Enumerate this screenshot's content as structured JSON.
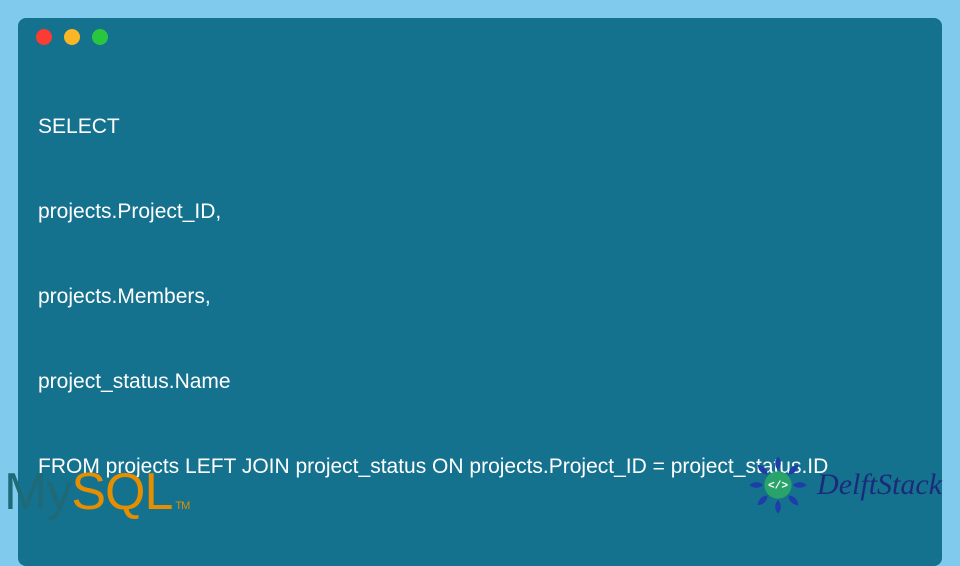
{
  "code": {
    "line1": "SELECT",
    "line2": "projects.Project_ID,",
    "line3": "projects.Members,",
    "line4": "project_status.Name",
    "line5": "FROM projects LEFT JOIN project_status ON projects.Project_ID = project_status.ID"
  },
  "logos": {
    "mysql_my": "My",
    "mysql_sql": "SQL",
    "mysql_tm": "TM",
    "delft": "DelftStack",
    "badge_text": "</>"
  }
}
